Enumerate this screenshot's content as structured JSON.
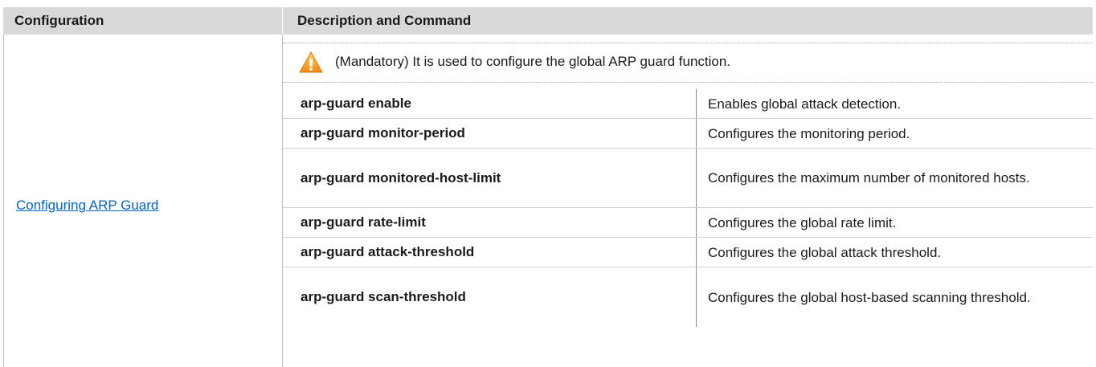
{
  "header": {
    "col1": "Configuration",
    "col2": "Description and Command"
  },
  "left_link": "Configuring ARP Guard",
  "note": {
    "icon": "warning-icon",
    "text": "(Mandatory) It is used to configure the global ARP guard function."
  },
  "commands": [
    {
      "cmd": "arp-guard enable",
      "desc": "Enables global attack detection."
    },
    {
      "cmd": "arp-guard monitor-period",
      "desc": "Configures the monitoring period."
    },
    {
      "cmd": "arp-guard monitored-host-limit",
      "desc": "Configures the maximum number of monitored hosts."
    },
    {
      "cmd": "arp-guard rate-limit",
      "desc": "Configures the global rate limit."
    },
    {
      "cmd": "arp-guard attack-threshold",
      "desc": "Configures the global attack threshold."
    },
    {
      "cmd": "arp-guard scan-threshold",
      "desc": "Configures the global host-based scanning threshold."
    }
  ],
  "colors": {
    "header_bg": "#d9d9d9",
    "link": "#0563c1",
    "warning": "#f5a623"
  }
}
